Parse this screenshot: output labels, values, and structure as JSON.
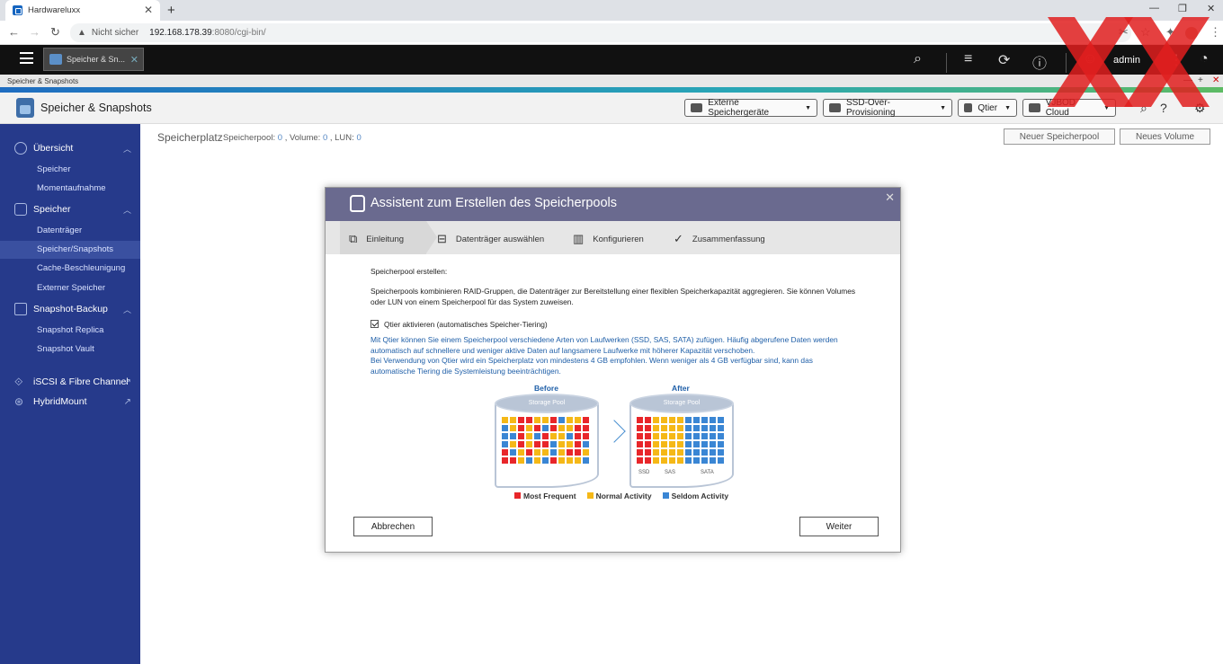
{
  "browser": {
    "tab_title": "Hardwareluxx",
    "new_tab_symbol": "+",
    "insecure_label": "Nicht sicher",
    "url_host": "192.168.178.39",
    "url_rest": ":8080/cgi-bin/"
  },
  "topbar": {
    "app_tab_label": "Speicher & Sn...",
    "user": "admin"
  },
  "title_strip": "Speicher & Snapshots",
  "header": {
    "app_name": "Speicher & Snapshots",
    "buttons": [
      "Externe Speichergeräte",
      "SSD-Over-Provisioning",
      "Qtier",
      "VJBOD Cloud"
    ]
  },
  "sidebar": {
    "sections": [
      {
        "label": "Übersicht",
        "items": [
          "Speicher",
          "Momentaufnahme"
        ]
      },
      {
        "label": "Speicher",
        "items": [
          "Datenträger",
          "Speicher/Snapshots",
          "Cache-Beschleunigung",
          "Externer Speicher"
        ]
      },
      {
        "label": "Snapshot-Backup",
        "items": [
          "Snapshot Replica",
          "Snapshot Vault"
        ]
      }
    ],
    "links": [
      "iSCSI & Fibre Channel",
      "HybridMount"
    ],
    "active_item": "Speicher/Snapshots"
  },
  "content": {
    "title": "Speicherplatz",
    "pool_label": "Speicherpool:",
    "pool_count": "0",
    "volume_label": ", Volume:",
    "volume_count": "0",
    "lun_label": ", LUN:",
    "lun_count": "0",
    "new_pool_button": "Neuer Speicherpool",
    "new_volume_button": "Neues Volume"
  },
  "dialog": {
    "title": "Assistent zum Erstellen des Speicherpools",
    "steps": [
      "Einleitung",
      "Datenträger auswählen",
      "Konfigurieren",
      "Zusammenfassung"
    ],
    "heading": "Speicherpool erstellen:",
    "description": "Speicherpools kombinieren RAID-Gruppen, die Datenträger zur Bereitstellung einer flexiblen Speicherkapazität aggregieren. Sie können Volumes oder LUN von einem Speicherpool für das System zuweisen.",
    "checkbox_label": "Qtier aktivieren (automatisches Speicher-Tiering)",
    "checkbox_checked": true,
    "info_line1": "Mit Qtier können Sie einem Speicherpool verschiedene Arten von Laufwerken (SSD, SAS, SATA) zufügen. Häufig abgerufene Daten werden automatisch auf schnellere und weniger aktive Daten auf langsamere Laufwerke mit höherer Kapazität verschoben.",
    "info_line2": "Bei Verwendung von Qtier wird ein Speicherplatz von mindestens 4 GB empfohlen. Wenn weniger als 4 GB verfügbar sind, kann das automatische Tiering die Systemleistung beeinträchtigen.",
    "diagram": {
      "before_label": "Before",
      "after_label": "After",
      "pool_label": "Storage Pool",
      "tiers": [
        "SSD",
        "SAS",
        "SATA"
      ],
      "legend": [
        "Most Frequent",
        "Normal Activity",
        "Seldom Activity"
      ],
      "colors": {
        "most": "#e8262a",
        "normal": "#f5b817",
        "seldom": "#3a86d4"
      }
    },
    "cancel_button": "Abbrechen",
    "next_button": "Weiter"
  }
}
